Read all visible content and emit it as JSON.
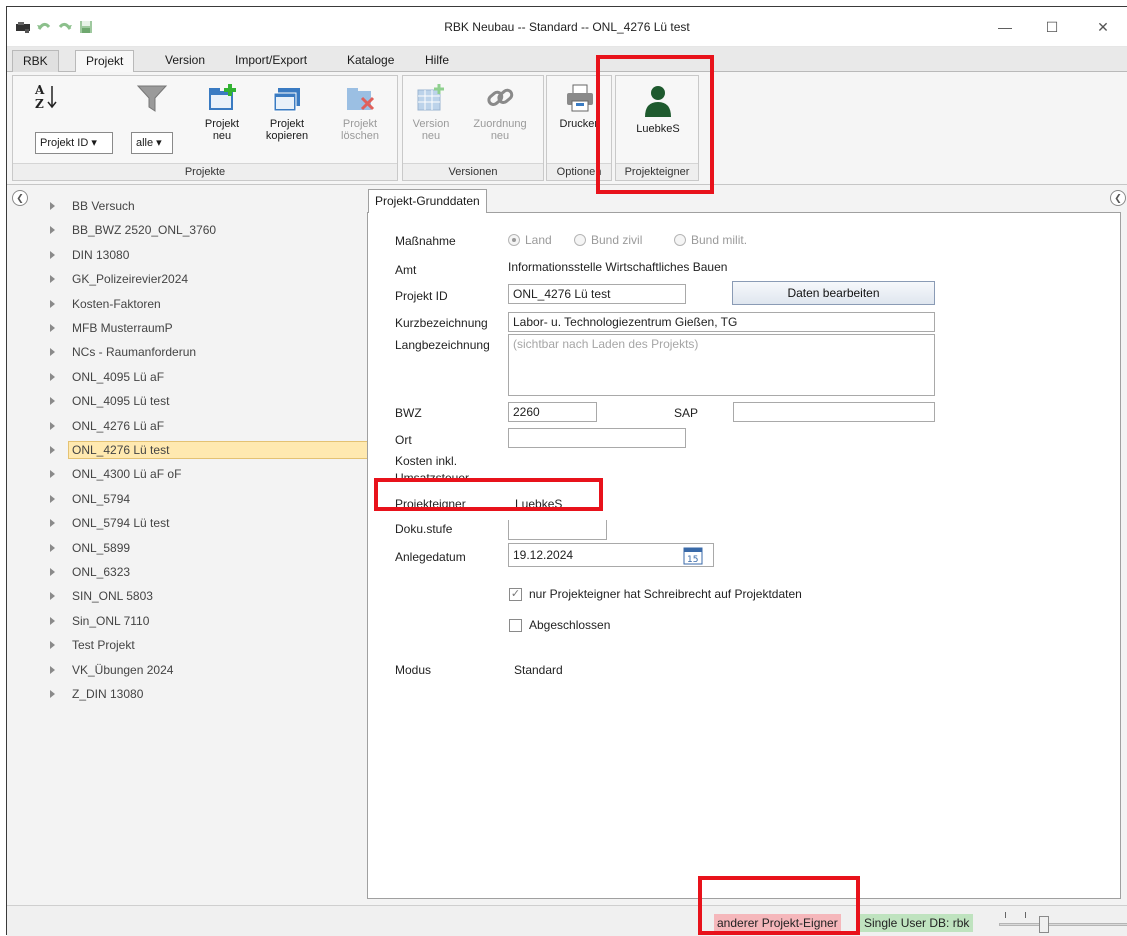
{
  "window": {
    "title": "RBK Neubau -- Standard -- ONL_4276 Lü test",
    "minimize": "—",
    "maximize": "☐",
    "close": "✕"
  },
  "menu_tabs": [
    "RBK",
    "Projekt",
    "Version",
    "Import/Export",
    "Kataloge",
    "Hilfe"
  ],
  "ribbon": {
    "projekte": {
      "label": "Projekte",
      "sort_combo": "Projekt ID ▾",
      "filter_combo": "alle ▾",
      "new_line1": "Projekt",
      "new_line2": "neu",
      "copy_line1": "Projekt",
      "copy_line2": "kopieren",
      "delete_line1": "Projekt",
      "delete_line2": "löschen"
    },
    "versionen": {
      "label": "Versionen",
      "version_line1": "Version",
      "version_line2": "neu",
      "assign_line1": "Zuordnung",
      "assign_line2": "neu"
    },
    "optionen": {
      "label": "Optionen",
      "print": "Drucken"
    },
    "projekteigner": {
      "label": "Projekteigner",
      "owner": "LuebkeS"
    }
  },
  "tree": {
    "items": [
      "BB Versuch",
      "BB_BWZ 2520_ONL_3760",
      "DIN 13080",
      "GK_Polizeirevier2024",
      "Kosten-Faktoren",
      "MFB MusterraumP",
      "NCs - Raumanforderun",
      "ONL_4095 Lü aF",
      "ONL_4095 Lü test",
      "ONL_4276 Lü aF",
      "ONL_4276 Lü test",
      "ONL_4300 Lü aF oF",
      "ONL_5794",
      "ONL_5794 Lü test",
      "ONL_5899",
      "ONL_6323",
      "SIN_ONL 5803",
      "Sin_ONL 7110",
      "Test Projekt",
      "VK_Übungen 2024",
      "Z_DIN 13080"
    ],
    "selected_index": 10
  },
  "form": {
    "tab_label": "Projekt-Grunddaten",
    "massnahme_label": "Maßnahme",
    "massnahme_options": [
      "Land",
      "Bund zivil",
      "Bund milit."
    ],
    "amt_label": "Amt",
    "amt_value": "Informationsstelle Wirtschaftliches Bauen",
    "projekt_id_label": "Projekt ID",
    "projekt_id_value": "ONL_4276 Lü test",
    "edit_button": "Daten bearbeiten",
    "kurz_label": "Kurzbezeichnung",
    "kurz_value": "Labor- u. Technologiezentrum Gießen, TG",
    "lang_label": "Langbezeichnung",
    "lang_placeholder": "(sichtbar nach Laden des Projekts)",
    "bwz_label": "BWZ",
    "bwz_value": "2260",
    "sap_label": "SAP",
    "sap_value": "",
    "ort_label": "Ort",
    "ort_value": "",
    "kosten_label_1": "Kosten inkl.",
    "kosten_label_2": "Umsatzsteuer",
    "eigner_label": "Projekteigner",
    "eigner_value": "LuebkeS",
    "doku_label": "Doku.stufe",
    "doku_value": "",
    "anlege_label": "Anlegedatum",
    "anlege_value": "19.12.2024",
    "calendar_day": "15",
    "write_check_label": "nur Projekteigner hat Schreibrecht auf Projektdaten",
    "write_check_mark": "✓",
    "closed_check_label": "Abgeschlossen",
    "modus_label": "Modus",
    "modus_value": "Standard"
  },
  "status": {
    "owner_warning": "anderer Projekt-Eigner",
    "db": "Single User DB: rbk"
  },
  "colors": {
    "highlight": "#e8121b",
    "owner_warning_bg": "#f5b7bb",
    "db_bg": "#bfe3bf",
    "selection_bg": "#ffe9b0"
  }
}
